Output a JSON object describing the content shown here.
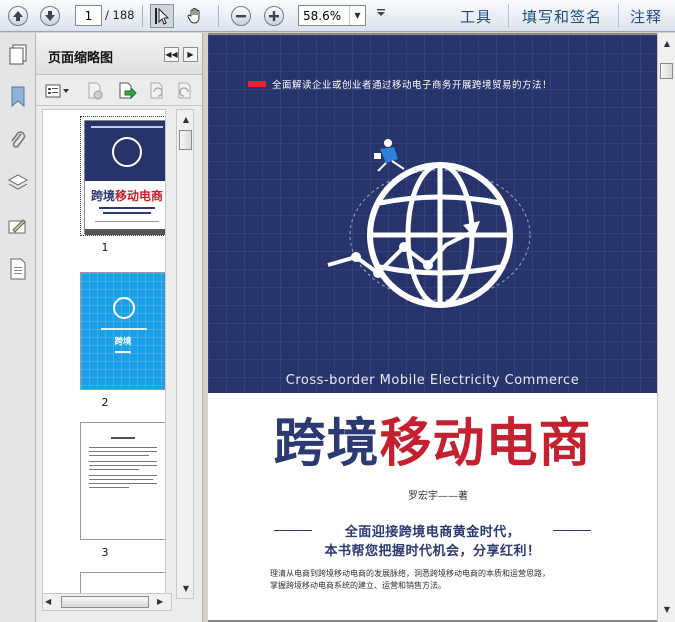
{
  "toolbar": {
    "page_current": "1",
    "page_total": "/ 188",
    "zoom_value": "58.6%",
    "menu_tools": "工具",
    "menu_fill_sign": "填写和签名",
    "menu_comment": "注释"
  },
  "panel": {
    "title": "页面缩略图",
    "thumbnails": [
      {
        "label": "1"
      },
      {
        "label": "2"
      },
      {
        "label": "3"
      }
    ]
  },
  "cover": {
    "tagline": "全面解读企业或创业者通过移动电子商务开展跨境贸易的方法！",
    "subtitle_en": "Cross-border Mobile Electricity Commerce",
    "title_part1": "跨境",
    "title_part2": "移动电商",
    "author": "罗宏宇——著",
    "slogan_line1": "全面迎接跨境电商黄金时代，",
    "slogan_line2": "本书帮您把握时代机会，分享红利！",
    "desc_line1": "理清从电商到跨境移动电商的发展脉络，洞悉跨境移动电商的本质和运营思路，",
    "desc_line2": "掌握跨境移动电商系统的建立、运营和销售方法。"
  },
  "colors": {
    "cover_navy": "#27346c",
    "title_red": "#c4202f",
    "accent_blue": "#1f4d86"
  }
}
